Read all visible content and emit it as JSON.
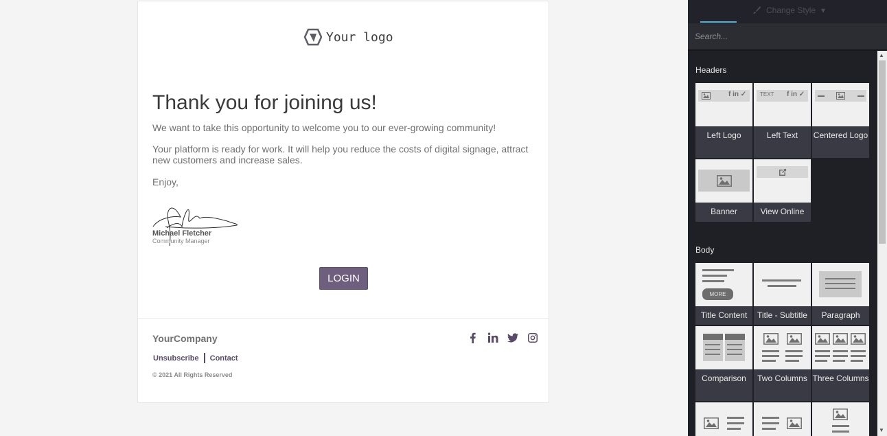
{
  "email": {
    "logo_text": "Your logo",
    "heading": "Thank you for joining us!",
    "para1": "We want to take this opportunity to welcome you to our ever-growing community!",
    "para2": "Your platform is ready for work. It will help you reduce the costs of digital signage, attract new customers and increase sales.",
    "para3": "Enjoy,",
    "signature_name": "Michael Fletcher",
    "signature_role": "Community Manager",
    "login_label": "LOGIN",
    "company": "YourCompany",
    "unsubscribe": "Unsubscribe",
    "contact": "Contact",
    "copyright": "© 2021 All Rights Reserved",
    "socials": [
      "facebook-icon",
      "linkedin-icon",
      "twitter-icon",
      "instagram-icon"
    ],
    "accent_color": "#6e5f7e"
  },
  "panel": {
    "change_style": "Change Style",
    "search_placeholder": "Search...",
    "headers_title": "Headers",
    "body_title": "Body",
    "headers": [
      {
        "label": "Left Logo"
      },
      {
        "label": "Left Text",
        "thumb_text": "TEXT"
      },
      {
        "label": "Centered Logo"
      },
      {
        "label": "Banner"
      },
      {
        "label": "View Online"
      }
    ],
    "body": [
      {
        "label": "Title Content",
        "thumb_text": "MORE"
      },
      {
        "label": "Title - Subtitle"
      },
      {
        "label": "Paragraph"
      },
      {
        "label": "Comparison"
      },
      {
        "label": "Two Columns"
      },
      {
        "label": "Three Columns"
      }
    ],
    "accent_color": "#4fb3d9",
    "background_color": "#1f1f26"
  }
}
